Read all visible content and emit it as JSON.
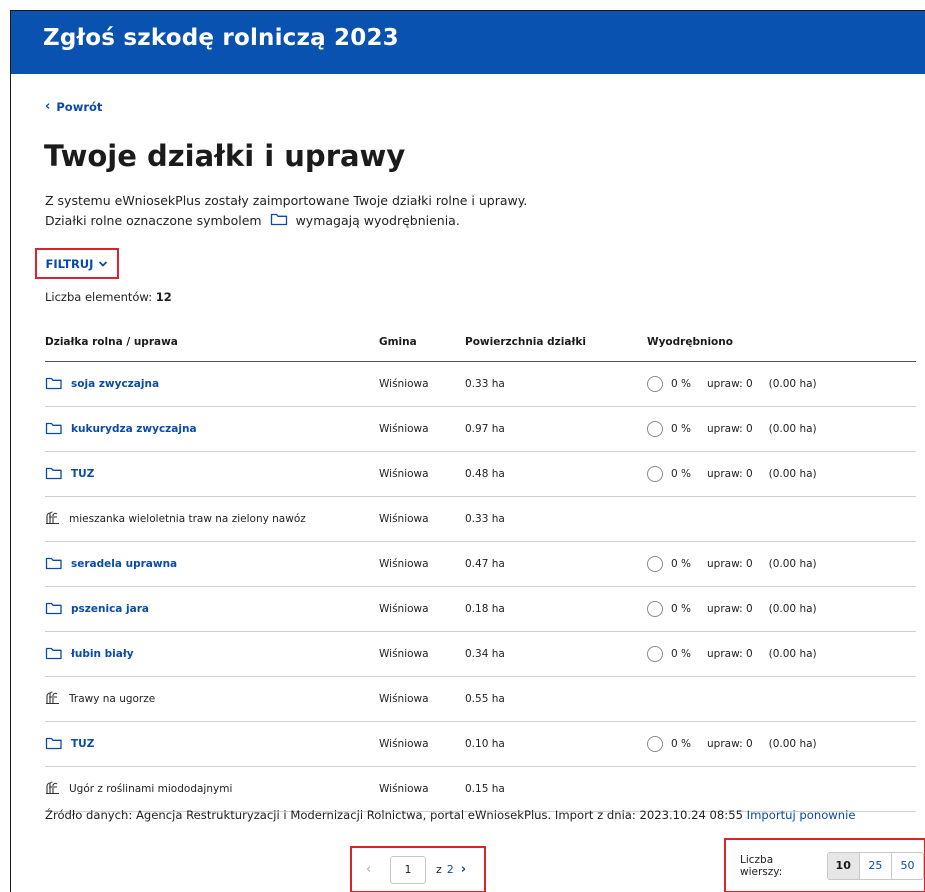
{
  "header": {
    "title": "Zgłoś szkodę rolniczą 2023"
  },
  "back": {
    "label": "Powrót"
  },
  "page": {
    "title": "Twoje działki i uprawy",
    "intro_line1": "Z systemu eWniosekPlus zostały zaimportowane Twoje działki rolne i uprawy.",
    "intro_line2_before": "Działki rolne oznaczone symbolem",
    "intro_line2_after": "wymagają wyodrębnienia."
  },
  "filter": {
    "label": "FILTRUJ"
  },
  "count": {
    "label": "Liczba elementów:",
    "value": "12"
  },
  "table": {
    "headers": [
      "Działka rolna / uprawa",
      "Gmina",
      "Powierzchnia działki",
      "Wyodrębniono"
    ],
    "rows": [
      {
        "icon": "folder-icon",
        "name": "soja zwyczajna",
        "link": true,
        "gmina": "Wiśniowa",
        "area": "0.33 ha",
        "pct": "0 %",
        "upraw": "upraw: 0",
        "ha": "(0.00 ha)"
      },
      {
        "icon": "folder-icon",
        "name": "kukurydza zwyczajna",
        "link": true,
        "gmina": "Wiśniowa",
        "area": "0.97 ha",
        "pct": "0 %",
        "upraw": "upraw: 0",
        "ha": "(0.00 ha)"
      },
      {
        "icon": "folder-icon",
        "name": "TUZ",
        "link": true,
        "gmina": "Wiśniowa",
        "area": "0.48 ha",
        "pct": "0 %",
        "upraw": "upraw: 0",
        "ha": "(0.00 ha)"
      },
      {
        "icon": "crop-icon",
        "name": "mieszanka wieloletnia traw na zielony nawóz",
        "link": false,
        "gmina": "Wiśniowa",
        "area": "0.33 ha"
      },
      {
        "icon": "folder-icon",
        "name": "seradela uprawna",
        "link": true,
        "gmina": "Wiśniowa",
        "area": "0.47 ha",
        "pct": "0 %",
        "upraw": "upraw: 0",
        "ha": "(0.00 ha)"
      },
      {
        "icon": "folder-icon",
        "name": "pszenica jara",
        "link": true,
        "gmina": "Wiśniowa",
        "area": "0.18 ha",
        "pct": "0 %",
        "upraw": "upraw: 0",
        "ha": "(0.00 ha)"
      },
      {
        "icon": "folder-icon",
        "name": "łubin biały",
        "link": true,
        "gmina": "Wiśniowa",
        "area": "0.34 ha",
        "pct": "0 %",
        "upraw": "upraw: 0",
        "ha": "(0.00 ha)"
      },
      {
        "icon": "crop-icon",
        "name": "Trawy na ugorze",
        "link": false,
        "gmina": "Wiśniowa",
        "area": "0.55 ha"
      },
      {
        "icon": "folder-icon",
        "name": "TUZ",
        "link": true,
        "gmina": "Wiśniowa",
        "area": "0.10 ha",
        "pct": "0 %",
        "upraw": "upraw: 0",
        "ha": "(0.00 ha)"
      },
      {
        "icon": "crop-icon",
        "name": "Ugór z roślinami miododajnymi",
        "link": false,
        "gmina": "Wiśniowa",
        "area": "0.15 ha"
      }
    ]
  },
  "source": {
    "text": "Źródło danych: Agencja Restrukturyzacji i Modernizacji Rolnictwa, portal eWniosekPlus. Import z dnia: 2023.10.24 08:55",
    "reimport": "Importuj ponownie"
  },
  "pagination": {
    "current": "1",
    "of": "z",
    "total": "2"
  },
  "rows_per_page": {
    "label": "Liczba wierszy:",
    "options": [
      "10",
      "25",
      "50"
    ],
    "selected": "10"
  },
  "colors": {
    "header": "#0a52b0",
    "link": "#0a4aa8",
    "highlight": "#d9232e"
  }
}
